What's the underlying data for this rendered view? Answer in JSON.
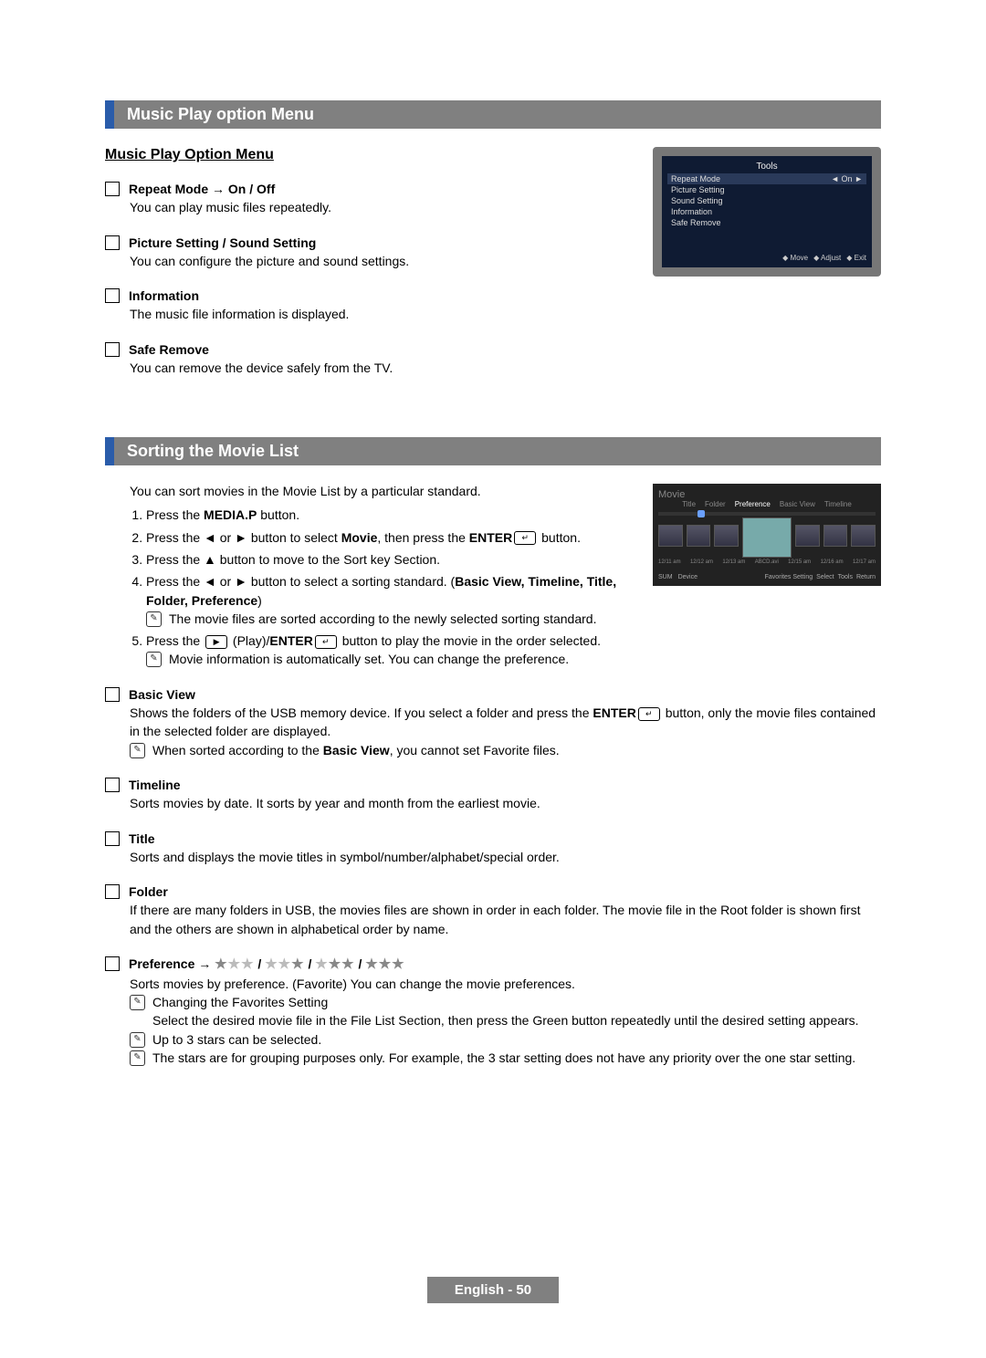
{
  "section1": {
    "header": "Music Play option Menu",
    "subhead": "Music Play Option Menu",
    "items": [
      {
        "title": "Repeat Mode → On / Off",
        "body": "You can play music files repeatedly."
      },
      {
        "title": "Picture Setting / Sound Setting",
        "body": "You can configure the picture and sound settings."
      },
      {
        "title": "Information",
        "body": "The music file information is displayed."
      },
      {
        "title": "Safe Remove",
        "body": "You can remove the device safely from the TV."
      }
    ],
    "tools_panel": {
      "title": "Tools",
      "rows": [
        "Repeat Mode",
        "Picture Setting",
        "Sound Setting",
        "Information",
        "Safe Remove"
      ],
      "selected_value_left": "◄",
      "selected_value": "On",
      "selected_value_right": "►",
      "foot": [
        "Move",
        "Adjust",
        "Exit"
      ]
    }
  },
  "section2": {
    "header": "Sorting the Movie List",
    "intro": "You can sort movies in the Movie List by a particular standard.",
    "steps": {
      "s1a": "Press the ",
      "s1b": "MEDIA.P",
      "s1c": " button.",
      "s2a": "Press the ◄ or ► button to select ",
      "s2b": "Movie",
      "s2c": ", then press the ",
      "s2d": "ENTER",
      "s2e": " button.",
      "s3": "Press the ▲ button to move to the Sort key Section.",
      "s4a": "Press the ◄ or ► button to select a sorting standard. (",
      "s4b": "Basic View, Timeline, Title, Folder, Preference",
      "s4c": ")",
      "s4note": "The movie files are sorted according to the newly selected sorting standard.",
      "s5a": "Press the ",
      "s5b": " (Play)/",
      "s5c": "ENTER",
      "s5d": " button to play the movie in the order selected.",
      "s5note": "Movie information is automatically set. You can change the preference."
    },
    "fig2": {
      "title": "Movie",
      "tabs": [
        "Title",
        "Folder",
        "Preference",
        "Basic View",
        "Timeline"
      ],
      "labels": [
        "12/11 am",
        "12/12 am",
        "12/13 am",
        "ABCD.avi",
        "12/15 am",
        "12/16 am",
        "12/17 am"
      ],
      "footL": [
        "SUM",
        "Device"
      ],
      "footR": [
        "Favorites Setting",
        "Select",
        "Tools",
        "Return"
      ]
    },
    "basic": {
      "title": "Basic View",
      "body_a": "Shows the folders of the USB memory device. If you select a folder and press the ",
      "body_b": "ENTER",
      "body_c": " button, only the movie files contained in the selected folder are displayed.",
      "note_a": "When sorted according to the ",
      "note_b": "Basic View",
      "note_c": ", you cannot set Favorite files."
    },
    "timeline": {
      "title": "Timeline",
      "body": "Sorts movies by date. It sorts by year and month from the earliest movie."
    },
    "titleItem": {
      "title": "Title",
      "body": "Sorts and displays the movie titles in symbol/number/alphabet/special order."
    },
    "folder": {
      "title": "Folder",
      "body": "If there are many folders in USB, the movies files are shown in order in each folder. The movie file in the Root folder is shown first and the others are shown in alphabetical order by name."
    },
    "pref": {
      "title": "Preference → ",
      "body": "Sorts movies by preference. (Favorite) You can change the movie preferences.",
      "n1": "Changing the Favorites Setting",
      "n1b": "Select the desired movie file in the File List Section, then press the Green button repeatedly until the desired setting appears.",
      "n2": "Up to 3 stars can be selected.",
      "n3": "The stars are for grouping purposes only. For example, the 3 star setting does not have any priority over the one star setting."
    }
  },
  "footer": "English - 50"
}
